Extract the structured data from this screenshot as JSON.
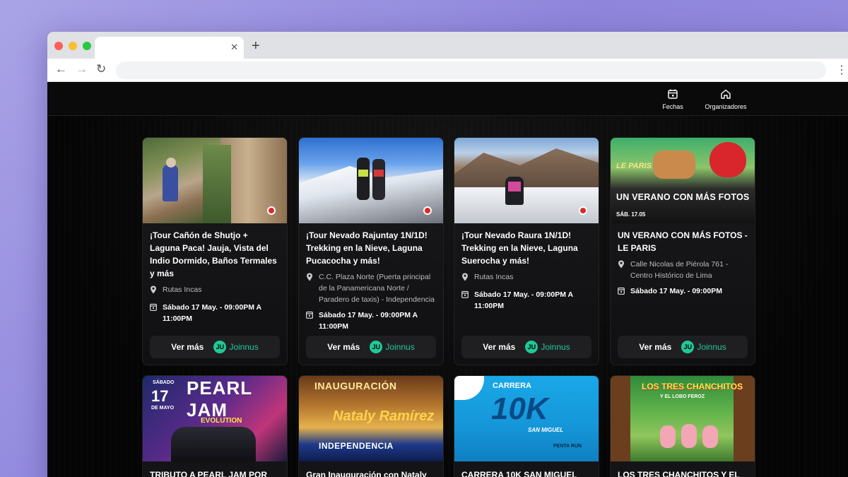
{
  "header": {
    "fechas_label": "Fechas",
    "organizadores_label": "Organizadores"
  },
  "cards": [
    {
      "title": "¡Tour Cañón de Shutjo + Laguna Paca! Jauja, Vista del Indio Dormido, Baños Termales y más",
      "organizer": "Rutas Incas",
      "date": "Sábado 17 May. - 09:00PM A 11:00PM",
      "cta": "Ver más",
      "brand": "Joinnus"
    },
    {
      "title": "¡Tour Nevado Rajuntay 1N/1D! Trekking en la Nieve, Laguna Pucacocha y más!",
      "location": "C.C. Plaza Norte (Puerta principal de la Panamericana Norte / Paradero de taxis) - Independencia",
      "date": "Sábado 17 May. - 09:00PM A 11:00PM",
      "cta": "Ver más",
      "brand": "Joinnus"
    },
    {
      "title": "¡Tour Nevado Raura 1N/1D! Trekking en la Nieve, Laguna Suerocha y más!",
      "organizer": "Rutas Incas",
      "date": "Sábado 17 May. - 09:00PM A 11:00PM",
      "cta": "Ver más",
      "brand": "Joinnus"
    },
    {
      "title": "UN VERANO CON MÁS FOTOS - LE PARIS",
      "location": "Calle Nicolas de Piérola 761 - Centro Histórico de Lima",
      "date": "Sábado 17 May. - 09:00PM",
      "cta": "Ver más",
      "brand": "Joinnus",
      "poster_text": "UN VERANO CON MÁS FOTOS",
      "poster_tag": "LE PARIS",
      "poster_date": "SÁB. 17.05"
    }
  ],
  "row2": [
    {
      "title": "TRIBUTO A PEARL JAM POR",
      "poster_text": "PEARL JAM",
      "poster_sub": "EVOLUTION",
      "poster_date": "17",
      "poster_month": "DE MAYO",
      "poster_day": "SÁBADO"
    },
    {
      "title": "Gran Inauguración con Nataly",
      "poster_text": "INAUGURACIÓN",
      "poster_name": "Nataly Ramírez",
      "poster_sub": "INDEPENDENCIA"
    },
    {
      "title": "CARRERA 10K SAN MIGUEL",
      "poster_text": "CARRERA",
      "poster_big": "10K",
      "poster_sub": "SAN MIGUEL",
      "poster_tag": "PENTA RUN"
    },
    {
      "title": "LOS TRES CHANCHITOS Y EL",
      "poster_text": "LOS TRES CHANCHITOS",
      "poster_sub": "Y EL LOBO FEROZ"
    }
  ]
}
